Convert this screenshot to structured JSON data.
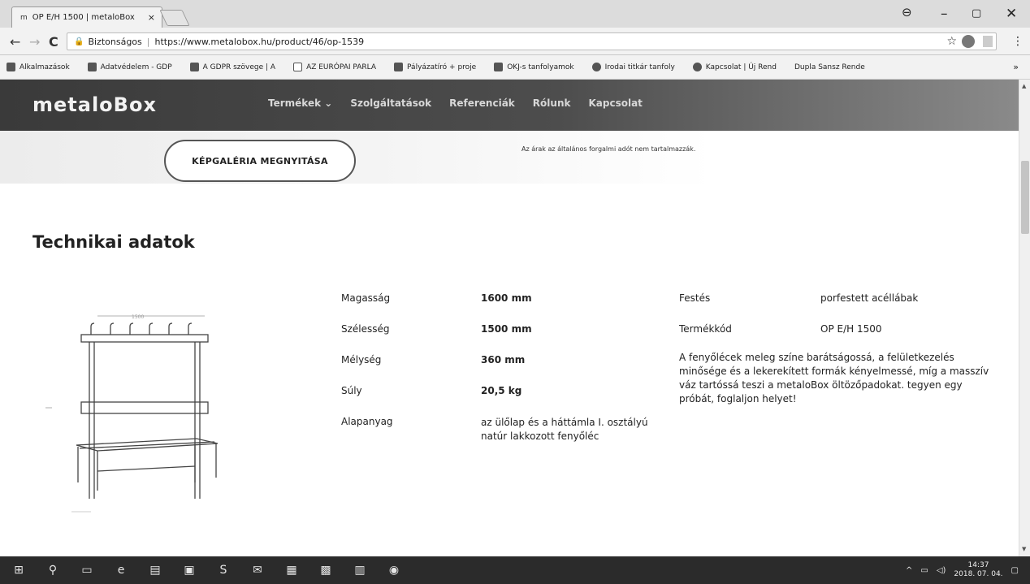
{
  "browser": {
    "tab_title": "OP E/H 1500 | metaloBox",
    "tab_favicon": "m",
    "tab_close": "×",
    "secure_label": "Biztonságos",
    "url": "https://www.metalobox.hu/product/46/op-1539",
    "bookmarks": [
      "Alkalmazások",
      "Adatvédelem - GDP",
      "A GDPR szövege | A",
      "AZ EURÓPAI PARLA",
      "Pályázatíró + proje",
      "OKJ-s tanfolyamok",
      "Irodai titkár tanfoly",
      "Kapcsolat | Új Rend",
      "Dupla Sansz Rende"
    ],
    "bookmarks_more": "»"
  },
  "site": {
    "logo": "metaloBox",
    "nav": [
      "Termékek ⌄",
      "Szolgáltatások",
      "Referenciák",
      "Rólunk",
      "Kapcsolat"
    ]
  },
  "content": {
    "gallery_button": "KÉPGALÉRIA MEGNYITÁSA",
    "vat_note": "Az árak az általános forgalmi adót nem tartalmazzák.",
    "section_title": "Technikai adatok",
    "specs_left": [
      {
        "label": "Magasság",
        "value": "1600 mm"
      },
      {
        "label": "Szélesség",
        "value": "1500 mm"
      },
      {
        "label": "Mélység",
        "value": "360 mm"
      },
      {
        "label": "Súly",
        "value": "20,5 kg"
      },
      {
        "label": "Alapanyag",
        "value": "az ülőlap és a háttámla I. osztályú natúr lakkozott fenyőléc"
      }
    ],
    "specs_right": [
      {
        "label": "Festés",
        "value": "porfestett acéllábak"
      },
      {
        "label": "Termékkód",
        "value": "OP E/H 1500"
      }
    ],
    "description": "A fenyőlécek meleg színe barátságossá, a felületkezelés minősége és a lekerekített formák kényelmessé, míg a masszív váz tartóssá teszi a metaloBox öltözőpadokat. tegyen egy próbát, foglaljon helyet!",
    "image_dimension_label": "1500"
  },
  "taskbar": {
    "time": "14:37",
    "date": "2018. 07. 04."
  }
}
